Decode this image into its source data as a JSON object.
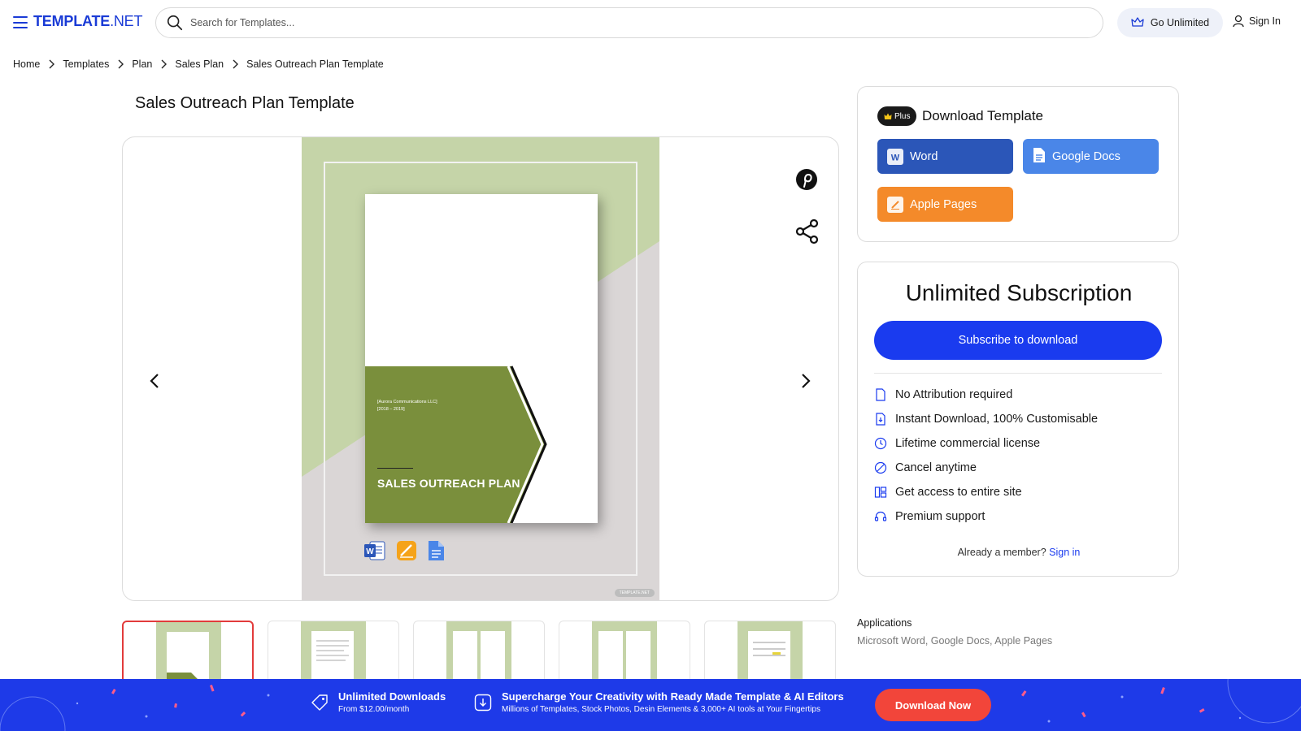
{
  "header": {
    "logo_main": "TEMPLATE",
    "logo_suffix": ".NET",
    "search_placeholder": "Search for Templates...",
    "go_unlimited": "Go Unlimited",
    "sign_in": "Sign In"
  },
  "breadcrumb": [
    "Home",
    "Templates",
    "Plan",
    "Sales Plan",
    "Sales Outreach Plan Template"
  ],
  "page_title": "Sales Outreach Plan Template",
  "preview": {
    "company_line1": "[Aurora Communications LLC]",
    "company_line2": "[2018 – 2019]",
    "doc_title": "SALES OUTREACH PLAN",
    "watermark": "TEMPLATE.NET",
    "icons": [
      "word-icon",
      "pages-icon",
      "google-docs-icon",
      "pinterest-icon",
      "share-icon",
      "chevron-left-icon",
      "chevron-right-icon"
    ]
  },
  "thumbnails_count": 5,
  "download": {
    "badge": "Plus",
    "title": "Download Template",
    "formats": [
      "Word",
      "Google Docs",
      "Apple Pages"
    ]
  },
  "subscription": {
    "title": "Unlimited Subscription",
    "button": "Subscribe to download",
    "features": [
      "No Attribution required",
      "Instant Download, 100% Customisable",
      "Lifetime commercial license",
      "Cancel anytime",
      "Get access to entire site",
      "Premium support"
    ],
    "member_text": "Already a member?",
    "member_link": "Sign in"
  },
  "applications": {
    "label": "Applications",
    "value": "Microsoft Word, Google Docs, Apple Pages"
  },
  "banner": {
    "item1_main": "Unlimited Downloads",
    "item1_sub": "From $12.00/month",
    "item2_main": "Supercharge Your Creativity with Ready Made Template & AI Editors",
    "item2_sub": "Millions of Templates, Stock Photos, Desin Elements & 3,000+ AI tools at Your Fingertips",
    "cta": "Download Now"
  },
  "colors": {
    "brand": "#1a3bd6",
    "subscribe": "#1a3bef",
    "word": "#2b56b8",
    "google_docs": "#4a86e8",
    "apple_pages": "#f48a2a",
    "doc_green": "#7a8f3c",
    "doc_light_green": "#c5d4a8",
    "banner_bg": "#1e3ae8",
    "cta": "#f2453a"
  }
}
